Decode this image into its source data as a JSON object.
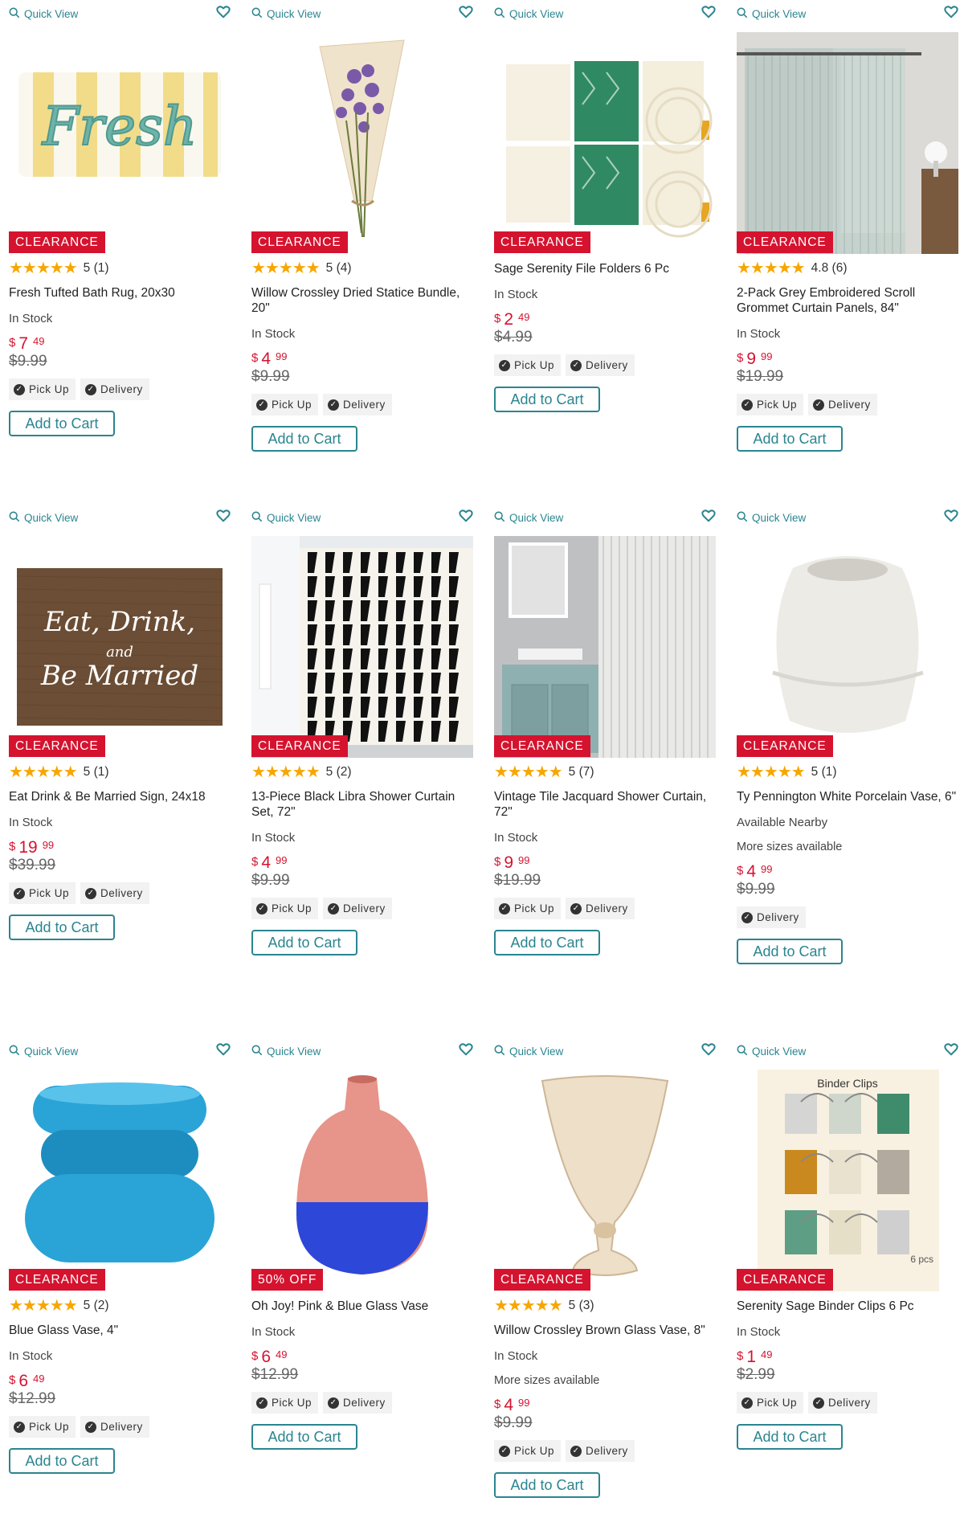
{
  "quick_view_label": "Quick View",
  "products": [
    {
      "badge": "CLEARANCE",
      "rating": "5",
      "reviews": "(1)",
      "title": "Fresh Tufted Bath Rug, 20x30",
      "availability": "In Stock",
      "more_sizes": "",
      "price_dollars": "7",
      "price_cents": "49",
      "was_price": "$9.99",
      "pickup": "Pick Up",
      "delivery": "Delivery",
      "add_to_cart": "Add to Cart"
    },
    {
      "badge": "CLEARANCE",
      "rating": "5",
      "reviews": "(4)",
      "title": "Willow Crossley Dried Statice Bundle, 20\"",
      "availability": "In Stock",
      "more_sizes": "",
      "price_dollars": "4",
      "price_cents": "99",
      "was_price": "$9.99",
      "pickup": "Pick Up",
      "delivery": "Delivery",
      "add_to_cart": "Add to Cart"
    },
    {
      "badge": "CLEARANCE",
      "rating": "",
      "reviews": "",
      "title": "Sage Serenity File Folders 6 Pc",
      "availability": "In Stock",
      "more_sizes": "",
      "price_dollars": "2",
      "price_cents": "49",
      "was_price": "$4.99",
      "pickup": "Pick Up",
      "delivery": "Delivery",
      "add_to_cart": "Add to Cart"
    },
    {
      "badge": "CLEARANCE",
      "rating": "4.8",
      "reviews": "(6)",
      "title": "2-Pack Grey Embroidered Scroll Grommet Curtain Panels, 84\"",
      "availability": "In Stock",
      "more_sizes": "",
      "price_dollars": "9",
      "price_cents": "99",
      "was_price": "$19.99",
      "pickup": "Pick Up",
      "delivery": "Delivery",
      "add_to_cart": "Add to Cart"
    },
    {
      "badge": "CLEARANCE",
      "rating": "5",
      "reviews": "(1)",
      "title": "Eat Drink & Be Married Sign, 24x18",
      "availability": "In Stock",
      "more_sizes": "",
      "price_dollars": "19",
      "price_cents": "99",
      "was_price": "$39.99",
      "pickup": "Pick Up",
      "delivery": "Delivery",
      "add_to_cart": "Add to Cart",
      "img_text": [
        "Eat, Drink,",
        "and",
        "Be Married"
      ]
    },
    {
      "badge": "CLEARANCE",
      "rating": "5",
      "reviews": "(2)",
      "title": "13-Piece Black Libra Shower Curtain Set, 72\"",
      "availability": "In Stock",
      "more_sizes": "",
      "price_dollars": "4",
      "price_cents": "99",
      "was_price": "$9.99",
      "pickup": "Pick Up",
      "delivery": "Delivery",
      "add_to_cart": "Add to Cart"
    },
    {
      "badge": "CLEARANCE",
      "rating": "5",
      "reviews": "(7)",
      "title": "Vintage Tile Jacquard Shower Curtain, 72\"",
      "availability": "In Stock",
      "more_sizes": "",
      "price_dollars": "9",
      "price_cents": "99",
      "was_price": "$19.99",
      "pickup": "Pick Up",
      "delivery": "Delivery",
      "add_to_cart": "Add to Cart"
    },
    {
      "badge": "CLEARANCE",
      "rating": "5",
      "reviews": "(1)",
      "title": "Ty Pennington White Porcelain Vase, 6\"",
      "availability": "Available Nearby",
      "more_sizes": "More sizes available",
      "price_dollars": "4",
      "price_cents": "99",
      "was_price": "$9.99",
      "pickup": "",
      "delivery": "Delivery",
      "add_to_cart": "Add to Cart"
    },
    {
      "badge": "CLEARANCE",
      "rating": "5",
      "reviews": "(2)",
      "title": "Blue Glass Vase, 4\"",
      "availability": "In Stock",
      "more_sizes": "",
      "price_dollars": "6",
      "price_cents": "49",
      "was_price": "$12.99",
      "pickup": "Pick Up",
      "delivery": "Delivery",
      "add_to_cart": "Add to Cart"
    },
    {
      "badge": "50% OFF",
      "rating": "",
      "reviews": "",
      "title": "Oh Joy! Pink & Blue Glass Vase",
      "availability": "In Stock",
      "more_sizes": "",
      "price_dollars": "6",
      "price_cents": "49",
      "was_price": "$12.99",
      "pickup": "Pick Up",
      "delivery": "Delivery",
      "add_to_cart": "Add to Cart"
    },
    {
      "badge": "CLEARANCE",
      "rating": "5",
      "reviews": "(3)",
      "title": "Willow Crossley Brown Glass Vase, 8\"",
      "availability": "In Stock",
      "more_sizes": "More sizes available",
      "price_dollars": "4",
      "price_cents": "99",
      "was_price": "$9.99",
      "pickup": "Pick Up",
      "delivery": "Delivery",
      "add_to_cart": "Add to Cart"
    },
    {
      "badge": "CLEARANCE",
      "rating": "",
      "reviews": "",
      "title": "Serenity Sage Binder Clips 6 Pc",
      "availability": "In Stock",
      "more_sizes": "",
      "price_dollars": "1",
      "price_cents": "49",
      "was_price": "$2.99",
      "pickup": "Pick Up",
      "delivery": "Delivery",
      "add_to_cart": "Add to Cart",
      "img_text": [
        "Binder Clips",
        "6 pcs"
      ]
    }
  ],
  "rug_text": "Fresh",
  "colors": {
    "accent": "#2a8590",
    "sale": "#d5132f",
    "star": "#f7a600"
  }
}
